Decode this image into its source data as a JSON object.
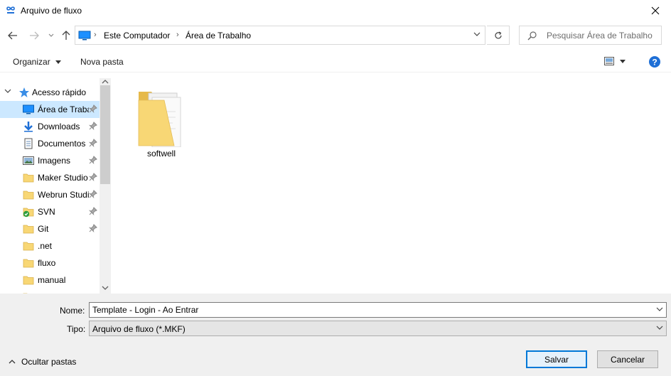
{
  "window": {
    "title": "Arquivo de fluxo"
  },
  "address": {
    "crumbs": [
      "Este Computador",
      "Área de Trabalho"
    ]
  },
  "search": {
    "placeholder": "Pesquisar Área de Trabalho"
  },
  "toolbar": {
    "organize_label": "Organizar",
    "new_folder_label": "Nova pasta"
  },
  "sidebar": {
    "root_label": "Acesso rápido",
    "items": [
      {
        "label": "Área de Trabalho",
        "icon": "desktop-icon",
        "pinned": true,
        "selected": true
      },
      {
        "label": "Downloads",
        "icon": "download-icon",
        "pinned": true
      },
      {
        "label": "Documentos",
        "icon": "documents-icon",
        "pinned": true
      },
      {
        "label": "Imagens",
        "icon": "pictures-icon",
        "pinned": true
      },
      {
        "label": "Maker Studio",
        "icon": "folder-icon",
        "pinned": true
      },
      {
        "label": "Webrun Studio",
        "icon": "folder-icon",
        "pinned": true
      },
      {
        "label": "SVN",
        "icon": "svn-folder-icon",
        "pinned": true
      },
      {
        "label": "Git",
        "icon": "folder-icon",
        "pinned": true
      },
      {
        "label": ".net",
        "icon": "folder-icon",
        "pinned": false
      },
      {
        "label": "fluxo",
        "icon": "folder-icon",
        "pinned": false
      },
      {
        "label": "manual",
        "icon": "folder-icon",
        "pinned": false
      }
    ]
  },
  "files": [
    {
      "name": "softwell",
      "icon": "folder-icon"
    }
  ],
  "form": {
    "name_label": "Nome:",
    "name_value": "Template - Login - Ao Entrar",
    "type_label": "Tipo:",
    "type_value": "Arquivo de fluxo (*.MKF)"
  },
  "footer": {
    "hide_folders_label": "Ocultar pastas",
    "save_label": "Salvar",
    "cancel_label": "Cancelar"
  },
  "colors": {
    "accent": "#0078d7",
    "selected": "#cce8ff",
    "folder": "#f8d775",
    "help": "#1e6fd6"
  }
}
